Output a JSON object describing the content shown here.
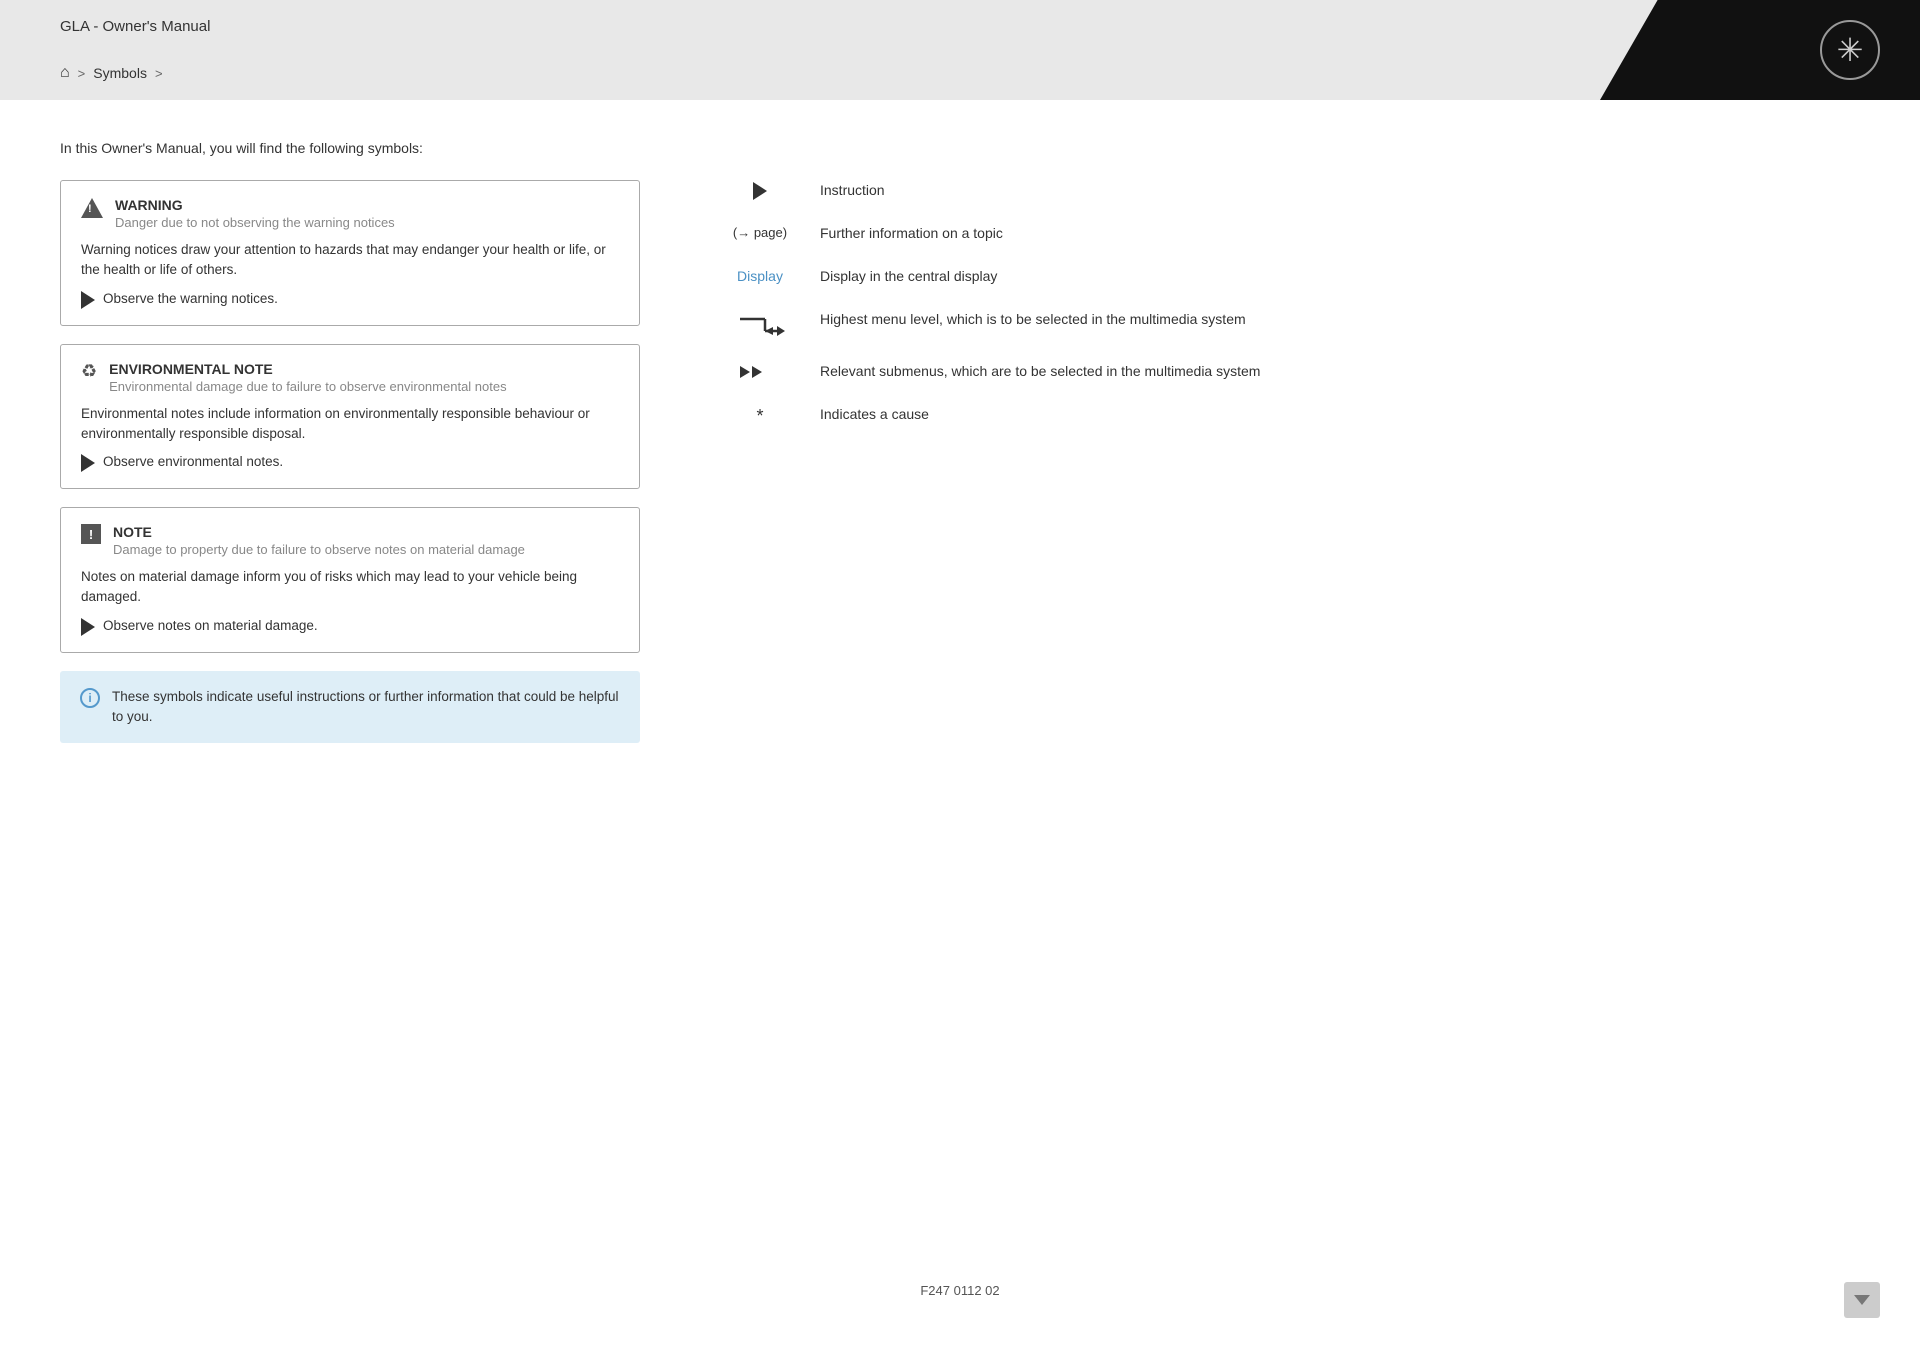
{
  "header": {
    "title": "GLA - Owner's Manual",
    "breadcrumb": {
      "home_icon": "⌂",
      "separator": ">",
      "item1": "Symbols",
      "separator2": ">"
    }
  },
  "intro": {
    "text": "In this Owner's Manual, you will find the following symbols:"
  },
  "notice_boxes": [
    {
      "id": "warning",
      "title": "WARNING",
      "subtitle": "Danger due to not observing the warning notices",
      "body": "Warning notices draw your attention to hazards that may endanger your health or life, or the health or life of others.",
      "action": "Observe the warning notices."
    },
    {
      "id": "environmental",
      "title": "ENVIRONMENTAL NOTE",
      "subtitle": "Environmental damage due to failure to observe environmental notes",
      "body": "Environmental notes include information on environmentally responsible behaviour or environmentally responsible disposal.",
      "action": "Observe environmental notes."
    },
    {
      "id": "note",
      "title": "NOTE",
      "subtitle": "Damage to property due to failure to observe notes on material damage",
      "body": "Notes on material damage inform you of risks which may lead to your vehicle being damaged.",
      "action": "Observe notes on material damage."
    }
  ],
  "info_box": {
    "text": "These symbols indicate useful instructions or further information that could be helpful to you."
  },
  "symbols": [
    {
      "id": "instruction",
      "icon_type": "play",
      "label": "Instruction"
    },
    {
      "id": "further-info",
      "icon_type": "arrow-page",
      "icon_text": "(→ page)",
      "label": "Further information on a topic"
    },
    {
      "id": "display",
      "icon_type": "display-text",
      "icon_text": "Display",
      "label": "Display in the central display"
    },
    {
      "id": "menu-level",
      "icon_type": "bent-arrow",
      "label": "Highest menu level, which is to be selected in the multimedia system"
    },
    {
      "id": "submenus",
      "icon_type": "double-arrow",
      "label": "Relevant submenus, which are to be selected in the multimedia system"
    },
    {
      "id": "cause",
      "icon_type": "asterisk",
      "icon_text": "*",
      "label": "Indicates a cause"
    }
  ],
  "footer": {
    "text": "F247 0112 02"
  }
}
